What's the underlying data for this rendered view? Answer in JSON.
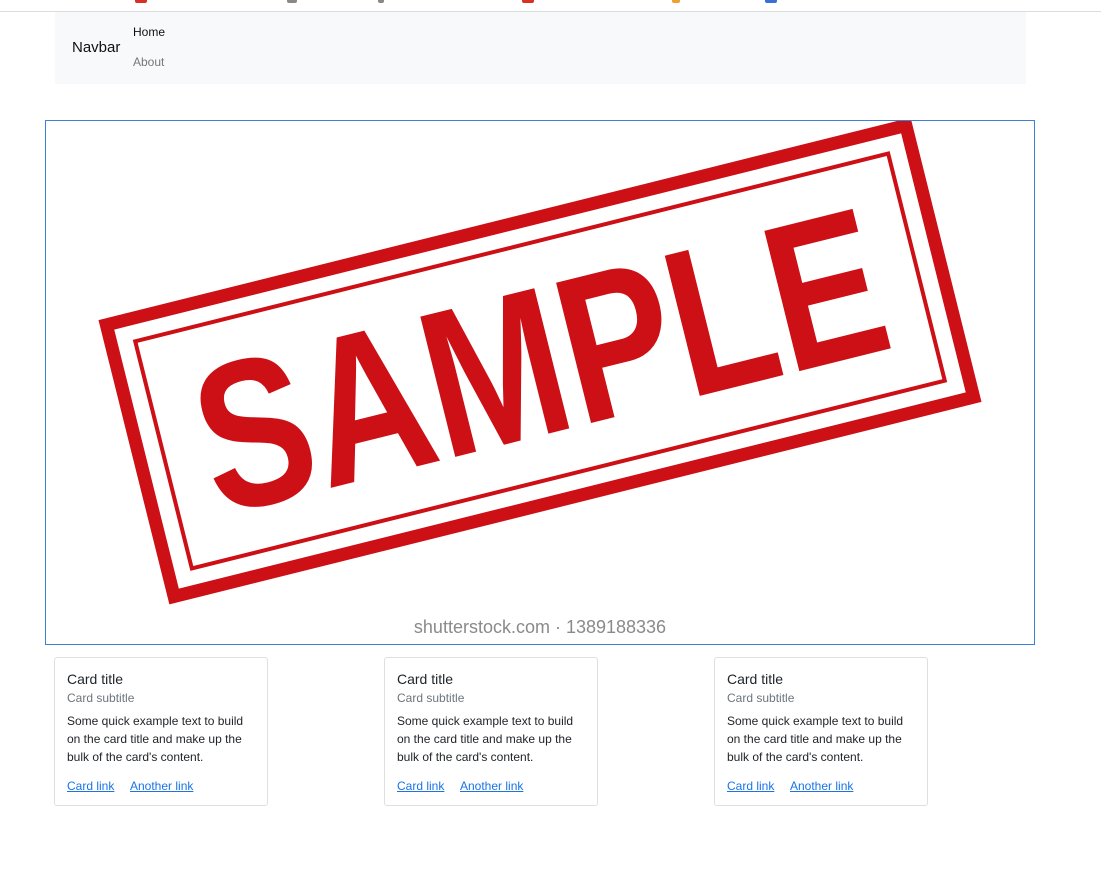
{
  "navbar": {
    "brand": "Navbar",
    "links": [
      "Home",
      "About"
    ]
  },
  "hero": {
    "stamp_text": "SAMPLE",
    "watermark": "shutterstock.com · 1389188336",
    "stamp_color": "#cc1016",
    "border_color": "#3b82d6"
  },
  "cards": [
    {
      "title": "Card title",
      "subtitle": "Card subtitle",
      "text": "Some quick example text to build on the card title and make up the bulk of the card's content.",
      "link1": "Card link",
      "link2": "Another link"
    },
    {
      "title": "Card title",
      "subtitle": "Card subtitle",
      "text": "Some quick example text to build on the card title and make up the bulk of the card's content.",
      "link1": "Card link",
      "link2": "Another link"
    },
    {
      "title": "Card title",
      "subtitle": "Card subtitle",
      "text": "Some quick example text to build on the card title and make up the bulk of the card's content.",
      "link1": "Card link",
      "link2": "Another link"
    }
  ],
  "colors": {
    "link": "#1a73e8",
    "navbar_bg": "#f8f9fa",
    "muted": "#6c757d"
  }
}
